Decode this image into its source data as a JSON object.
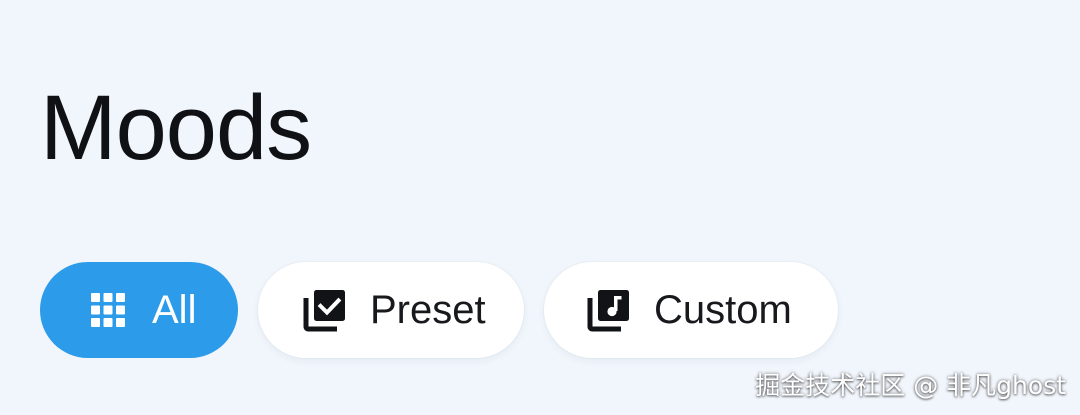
{
  "page": {
    "title": "Moods"
  },
  "filter_chips": [
    {
      "label": "All",
      "icon": "grid-icon",
      "selected": true
    },
    {
      "label": "Preset",
      "icon": "preset-library-icon",
      "selected": false
    },
    {
      "label": "Custom",
      "icon": "music-library-icon",
      "selected": false
    }
  ],
  "watermark": {
    "text": "掘金技术社区 @ 非凡ghost"
  },
  "colors": {
    "background": "#f1f6fc",
    "accent": "#2c9be9",
    "chip_background": "#ffffff",
    "title_text": "#0f1114"
  }
}
